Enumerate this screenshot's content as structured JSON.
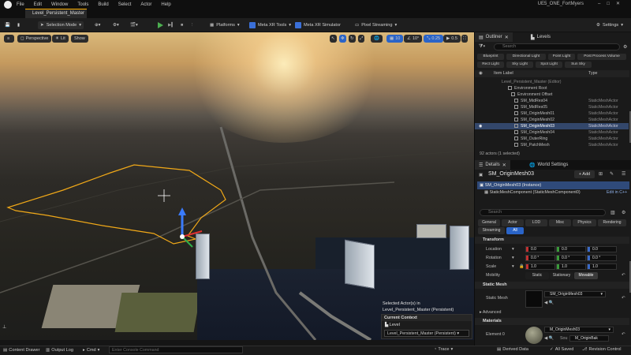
{
  "menu": {
    "items": [
      "File",
      "Edit",
      "Window",
      "Tools",
      "Build",
      "Select",
      "Actor",
      "Help"
    ],
    "project": "UE5_ONE_FortMyers"
  },
  "tab": {
    "level": "Level_Persistent_Master"
  },
  "toolbar": {
    "selection_mode": "Selection Mode",
    "platforms": "Platforms",
    "xr_tools": "Meta XR Tools",
    "xr_sim": "Meta XR Simulator",
    "pixel": "Pixel Streaming",
    "settings": "Settings"
  },
  "viewport": {
    "perspective": "Perspective",
    "lit": "Lit",
    "show": "Show",
    "snap_angle": "10°",
    "snap_scale": "0.25",
    "cam_speed": "0.5",
    "grid": "10",
    "selected_label": "Selected Actor(s) in",
    "selected_value": "Level_Persistent_Master (Persistent)",
    "current_context": "Current Context",
    "level_label": "Level",
    "level_value": "Level_Persistent_Master (Persistent)"
  },
  "status": {
    "content_drawer": "Content Drawer",
    "output_log": "Output Log",
    "cmd": "Cmd",
    "console_placeholder": "Enter Console Command",
    "trace": "Trace",
    "derived_data": "Derived Data",
    "all_saved": "All Saved",
    "revision": "Revision Control"
  },
  "outliner": {
    "tab": "Outliner",
    "levels_tab": "Levels",
    "search_placeholder": "Search",
    "filters": [
      "Blueprint",
      "Directional Light",
      "Point Light",
      "Post Process Volume",
      "Rect Light",
      "Sky Light",
      "Spot Light",
      "Sun Sky"
    ],
    "col_label": "Item Label",
    "col_type": "Type",
    "rows": [
      {
        "label": "Level_Persistent_Master (Editor)",
        "type": ""
      },
      {
        "label": "Environment Root",
        "type": ""
      },
      {
        "label": "Environment Offset",
        "type": ""
      },
      {
        "label": "SM_MidRes04",
        "type": "StaticMeshActor"
      },
      {
        "label": "SM_MidRes05",
        "type": "StaticMeshActor"
      },
      {
        "label": "SM_OriginMesh01",
        "type": "StaticMeshActor"
      },
      {
        "label": "SM_OriginMesh02",
        "type": "StaticMeshActor"
      },
      {
        "label": "SM_OriginMesh03",
        "type": "StaticMeshActor"
      },
      {
        "label": "SM_OriginMesh04",
        "type": "StaticMeshActor"
      },
      {
        "label": "SM_OuterRing",
        "type": "StaticMeshActor"
      },
      {
        "label": "SM_PatchMesh",
        "type": "StaticMeshActor"
      }
    ],
    "count": "92 actors (1 selected)"
  },
  "details": {
    "tab": "Details",
    "world_tab": "World Settings",
    "actor_name": "SM_OriginMesh03",
    "add": "+ Add",
    "instance": "SM_OriginMesh03 (Instance)",
    "component": "StaticMeshComponent (StaticMeshComponent0)",
    "edit_cpp": "Edit in C++",
    "search_placeholder": "Search",
    "tabs_row1": [
      "General",
      "Actor",
      "LOD",
      "Misc",
      "Physics",
      "Rendering"
    ],
    "tabs_row2": [
      "Streaming",
      "All"
    ],
    "transform": "Transform",
    "location": "Location",
    "rotation": "Rotation",
    "scale": "Scale",
    "loc": [
      "0.0",
      "0.0",
      "0.0"
    ],
    "rot": [
      "0.0 °",
      "0.0 °",
      "0.0 °"
    ],
    "scl": [
      "1.0",
      "1.0",
      "1.0"
    ],
    "mobility": "Mobility",
    "mob_opts": [
      "Static",
      "Stationary",
      "Movable"
    ],
    "static_mesh_sect": "Static Mesh",
    "static_mesh_lbl": "Static Mesh",
    "mesh_value": "SM_OriginMesh03",
    "advanced": "Advanced",
    "materials": "Materials",
    "element": "Element 0",
    "mat_value": "M_OriginMesh03",
    "mat_sub": "M_OriginBak"
  }
}
